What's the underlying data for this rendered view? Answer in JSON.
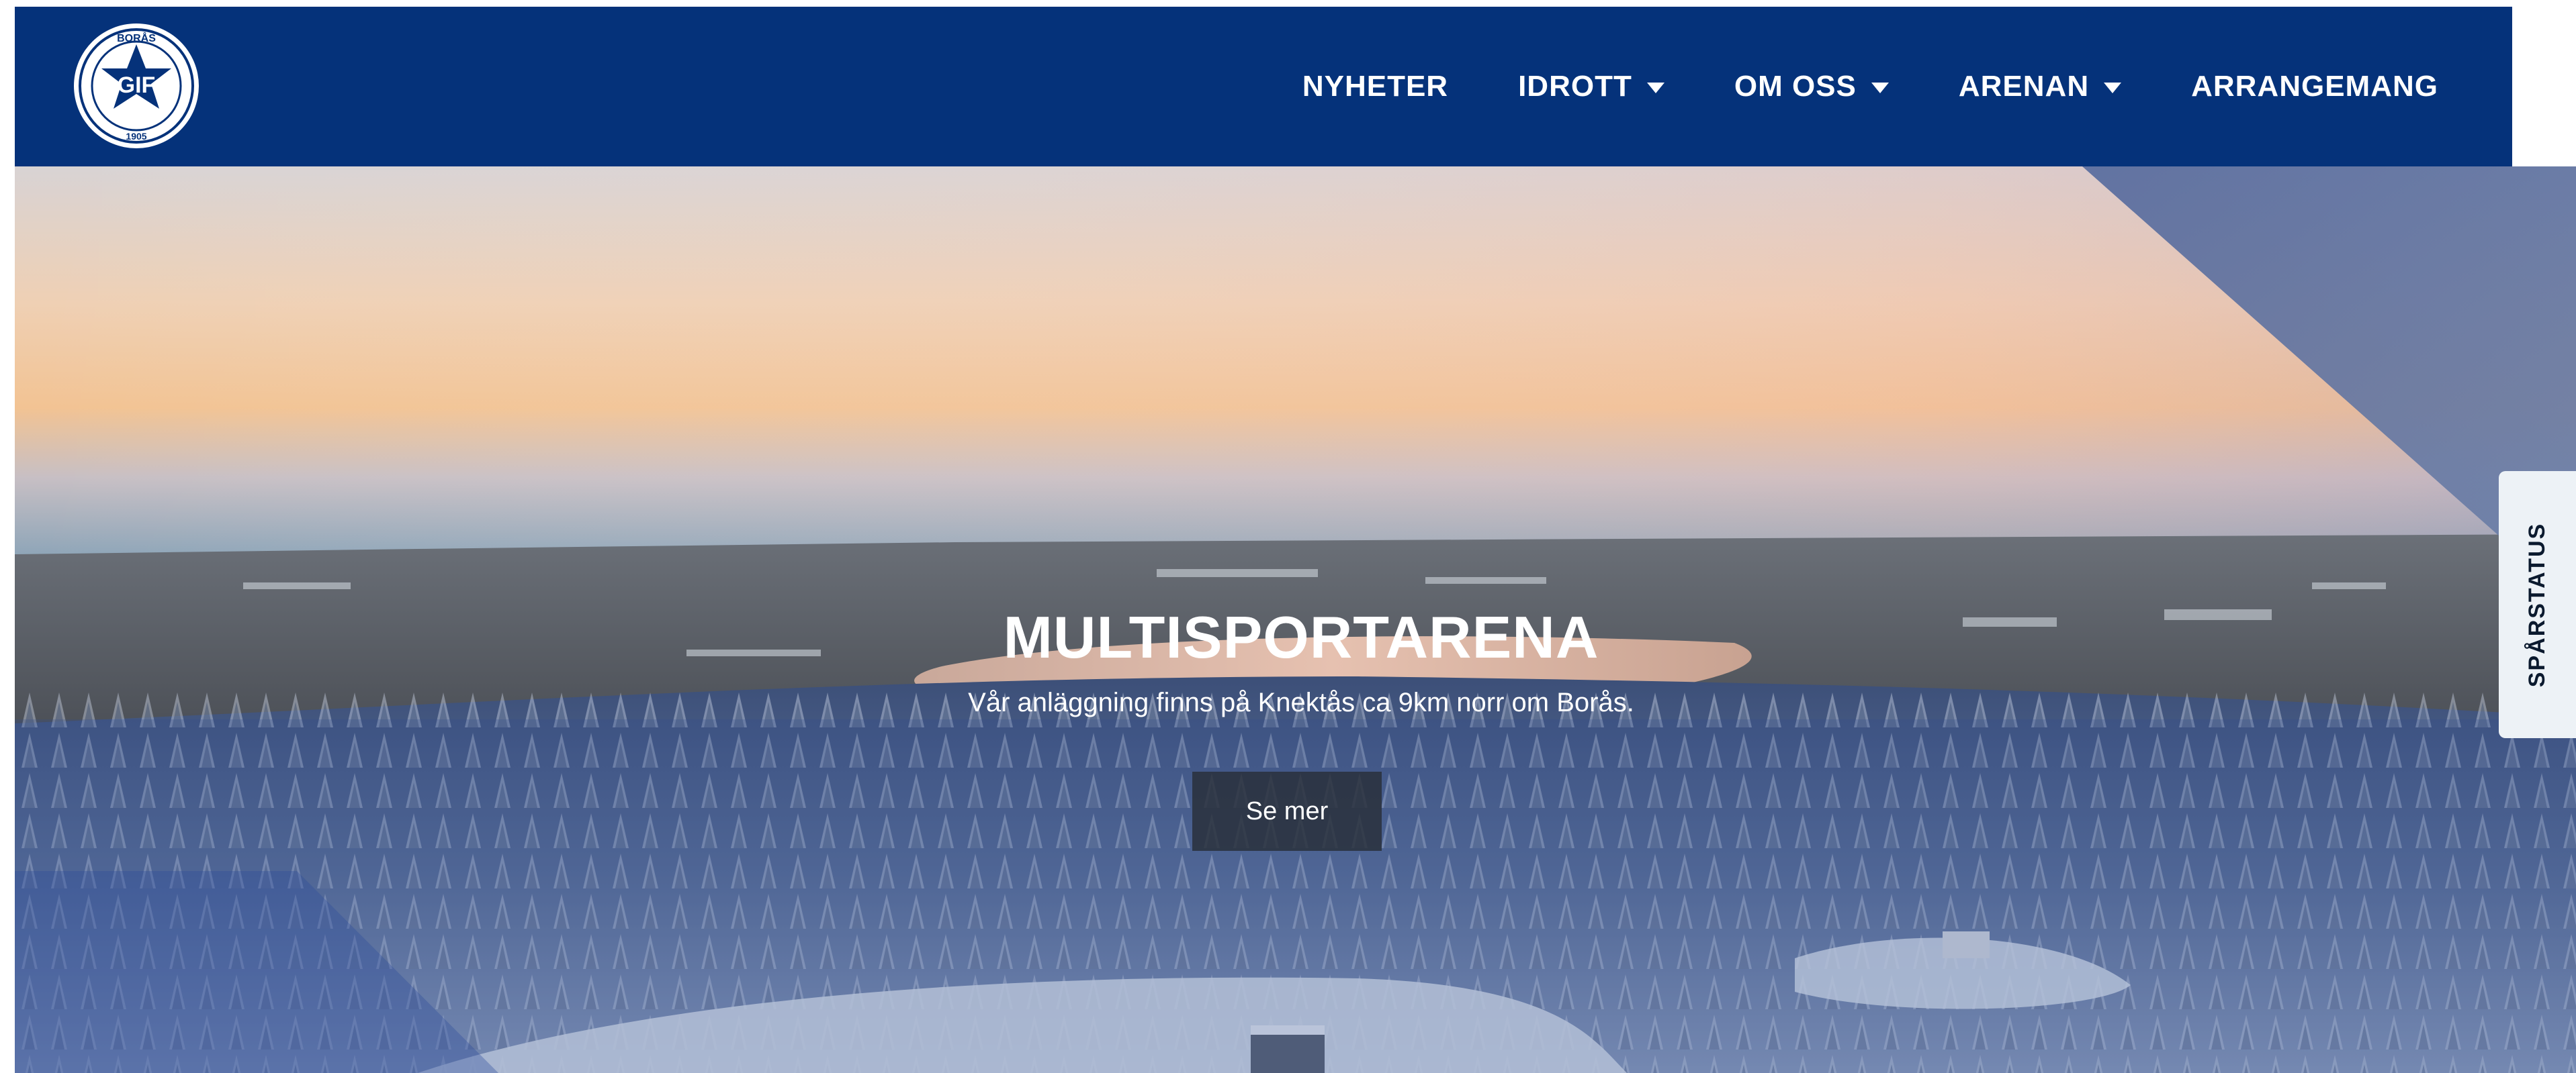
{
  "header": {
    "logo_alt": "Borås GIF",
    "logo_text": "GIF",
    "logo_ring_top": "BORÅS",
    "logo_ring_bottom": "1905",
    "nav": [
      {
        "label": "NYHETER",
        "has_dropdown": false
      },
      {
        "label": "IDROTT",
        "has_dropdown": true
      },
      {
        "label": "OM OSS",
        "has_dropdown": true
      },
      {
        "label": "ARENAN",
        "has_dropdown": true
      },
      {
        "label": "ARRANGEMANG",
        "has_dropdown": false
      }
    ]
  },
  "hero": {
    "title": "MULTISPORTARENA",
    "subtitle": "Vår anläggning finns på Knektås ca 9km norr om Borås.",
    "button_label": "Se mer"
  },
  "side_tab": {
    "label": "SPÅRSTATUS"
  },
  "colors": {
    "brand": "#05327a",
    "button_bg": "#282e38",
    "side_tab_bg": "#edf2f6"
  }
}
